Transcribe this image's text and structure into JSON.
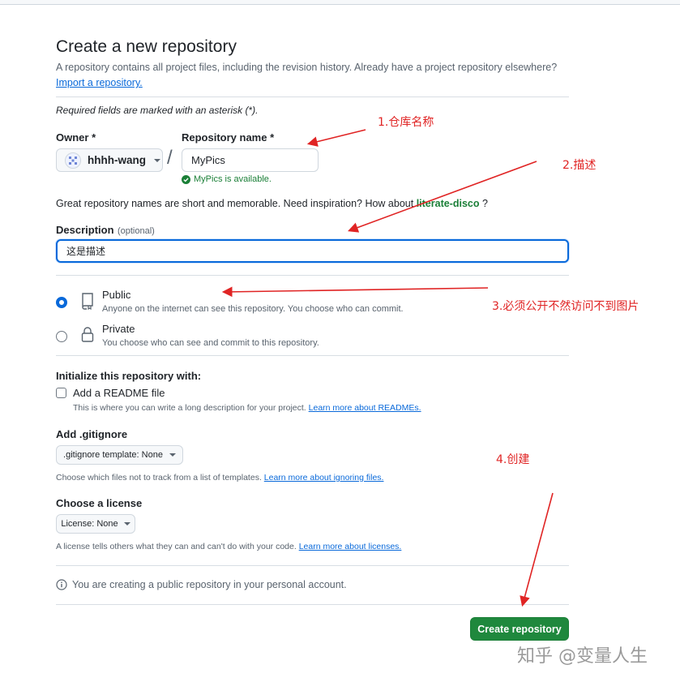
{
  "header": {
    "title": "Create a new repository",
    "subtitle": "A repository contains all project files, including the revision history. Already have a project repository elsewhere?",
    "import_link": "Import a repository."
  },
  "required_note": "Required fields are marked with an asterisk (*).",
  "owner": {
    "label": "Owner *",
    "value": "hhhh-wang"
  },
  "separator": "/",
  "repo_name": {
    "label": "Repository name *",
    "value": "MyPics",
    "available": "MyPics is available."
  },
  "inspiration": {
    "text": "Great repository names are short and memorable. Need inspiration? How about",
    "suggestion": "literate-disco",
    "suffix": "?"
  },
  "description": {
    "label": "Description",
    "optional": "(optional)",
    "value": "这是描述"
  },
  "visibility": {
    "public": {
      "label": "Public",
      "desc": "Anyone on the internet can see this repository. You choose who can commit.",
      "selected": true
    },
    "private": {
      "label": "Private",
      "desc": "You choose who can see and commit to this repository.",
      "selected": false
    }
  },
  "init": {
    "title": "Initialize this repository with:",
    "readme_label": "Add a README file",
    "readme_desc": "This is where you can write a long description for your project.",
    "readme_link": "Learn more about READMEs.",
    "readme_checked": false
  },
  "gitignore": {
    "title": "Add .gitignore",
    "button": ".gitignore template: None",
    "desc": "Choose which files not to track from a list of templates.",
    "link": "Learn more about ignoring files."
  },
  "license": {
    "title": "Choose a license",
    "button": "License: None",
    "desc": "A license tells others what they can and can't do with your code.",
    "link": "Learn more about licenses."
  },
  "footer_note": "You are creating a public repository in your personal account.",
  "create_button": "Create repository",
  "annotations": {
    "a1": "1.仓库名称",
    "a2": "2.描述",
    "a3": "3.必须公开不然访问不到图片",
    "a4": "4.创建"
  },
  "watermark": "知乎 @变量人生",
  "colors": {
    "accent": "#0969da",
    "success": "#1f883d",
    "annotation": "#e02424"
  },
  "icons": [
    "owner-avatar-icon",
    "caret-down-icon",
    "check-circle-icon",
    "repo-icon",
    "lock-icon",
    "info-icon"
  ]
}
